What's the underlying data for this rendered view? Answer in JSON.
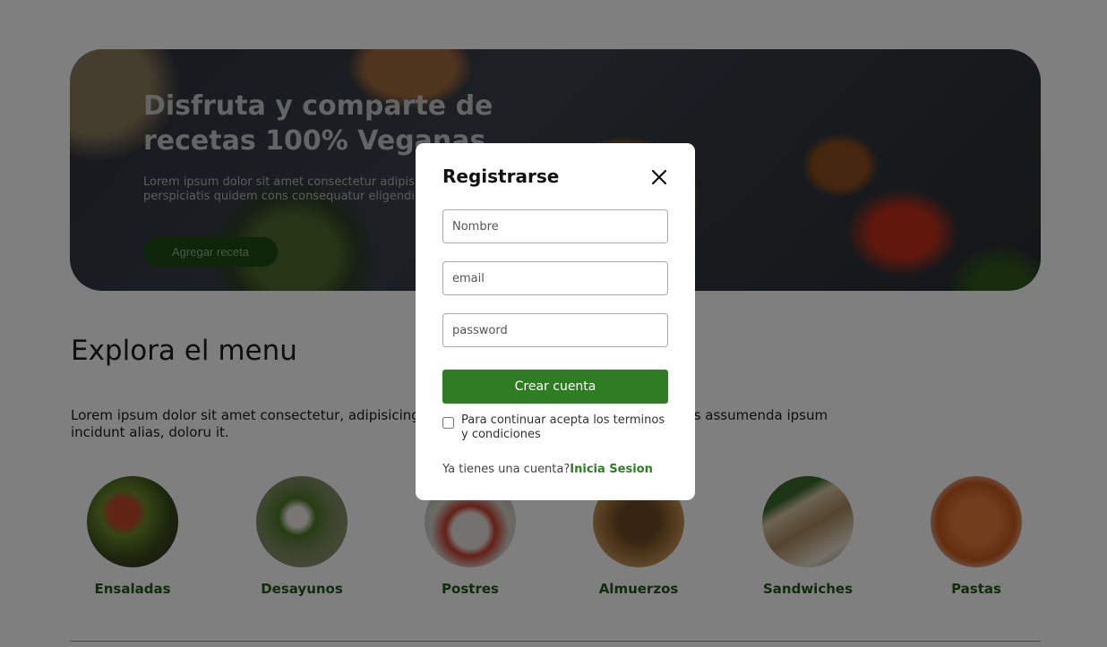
{
  "hero": {
    "title": "Disfruta y comparte de recetas 100% Veganas",
    "text": "Lorem ipsum dolor sit amet consectetur adipisicing repellat ea, modi veniam, perspiciatis quidem cons consequatur eligendi repellendus ducimus magnam",
    "button_label": "Agregar receta"
  },
  "menu": {
    "title": "Explora el menu",
    "description": "Lorem ipsum dolor sit amet consectetur, adipisicing eli                              umque commodi culpa vero reiciendis assumenda ipsum incidunt alias, doloru                              it."
  },
  "categories": [
    {
      "label": "Ensaladas"
    },
    {
      "label": "Desayunos"
    },
    {
      "label": "Postres"
    },
    {
      "label": "Almuerzos"
    },
    {
      "label": "Sandwiches"
    },
    {
      "label": "Pastas"
    }
  ],
  "modal": {
    "title": "Registrarse",
    "name_placeholder": "Nombre",
    "email_placeholder": "email",
    "password_placeholder": "password",
    "submit_label": "Crear cuenta",
    "terms_text": "Para continuar acepta los terminos y condiciones",
    "login_prompt": "Ya tienes una cuenta?",
    "login_link": "Inicia Sesion"
  },
  "colors": {
    "accent_green": "#2e7d22",
    "category_label_green": "#1f5a16",
    "overlay": "rgba(0,0,0,0.5)"
  },
  "icons": {
    "close": "close-icon"
  }
}
